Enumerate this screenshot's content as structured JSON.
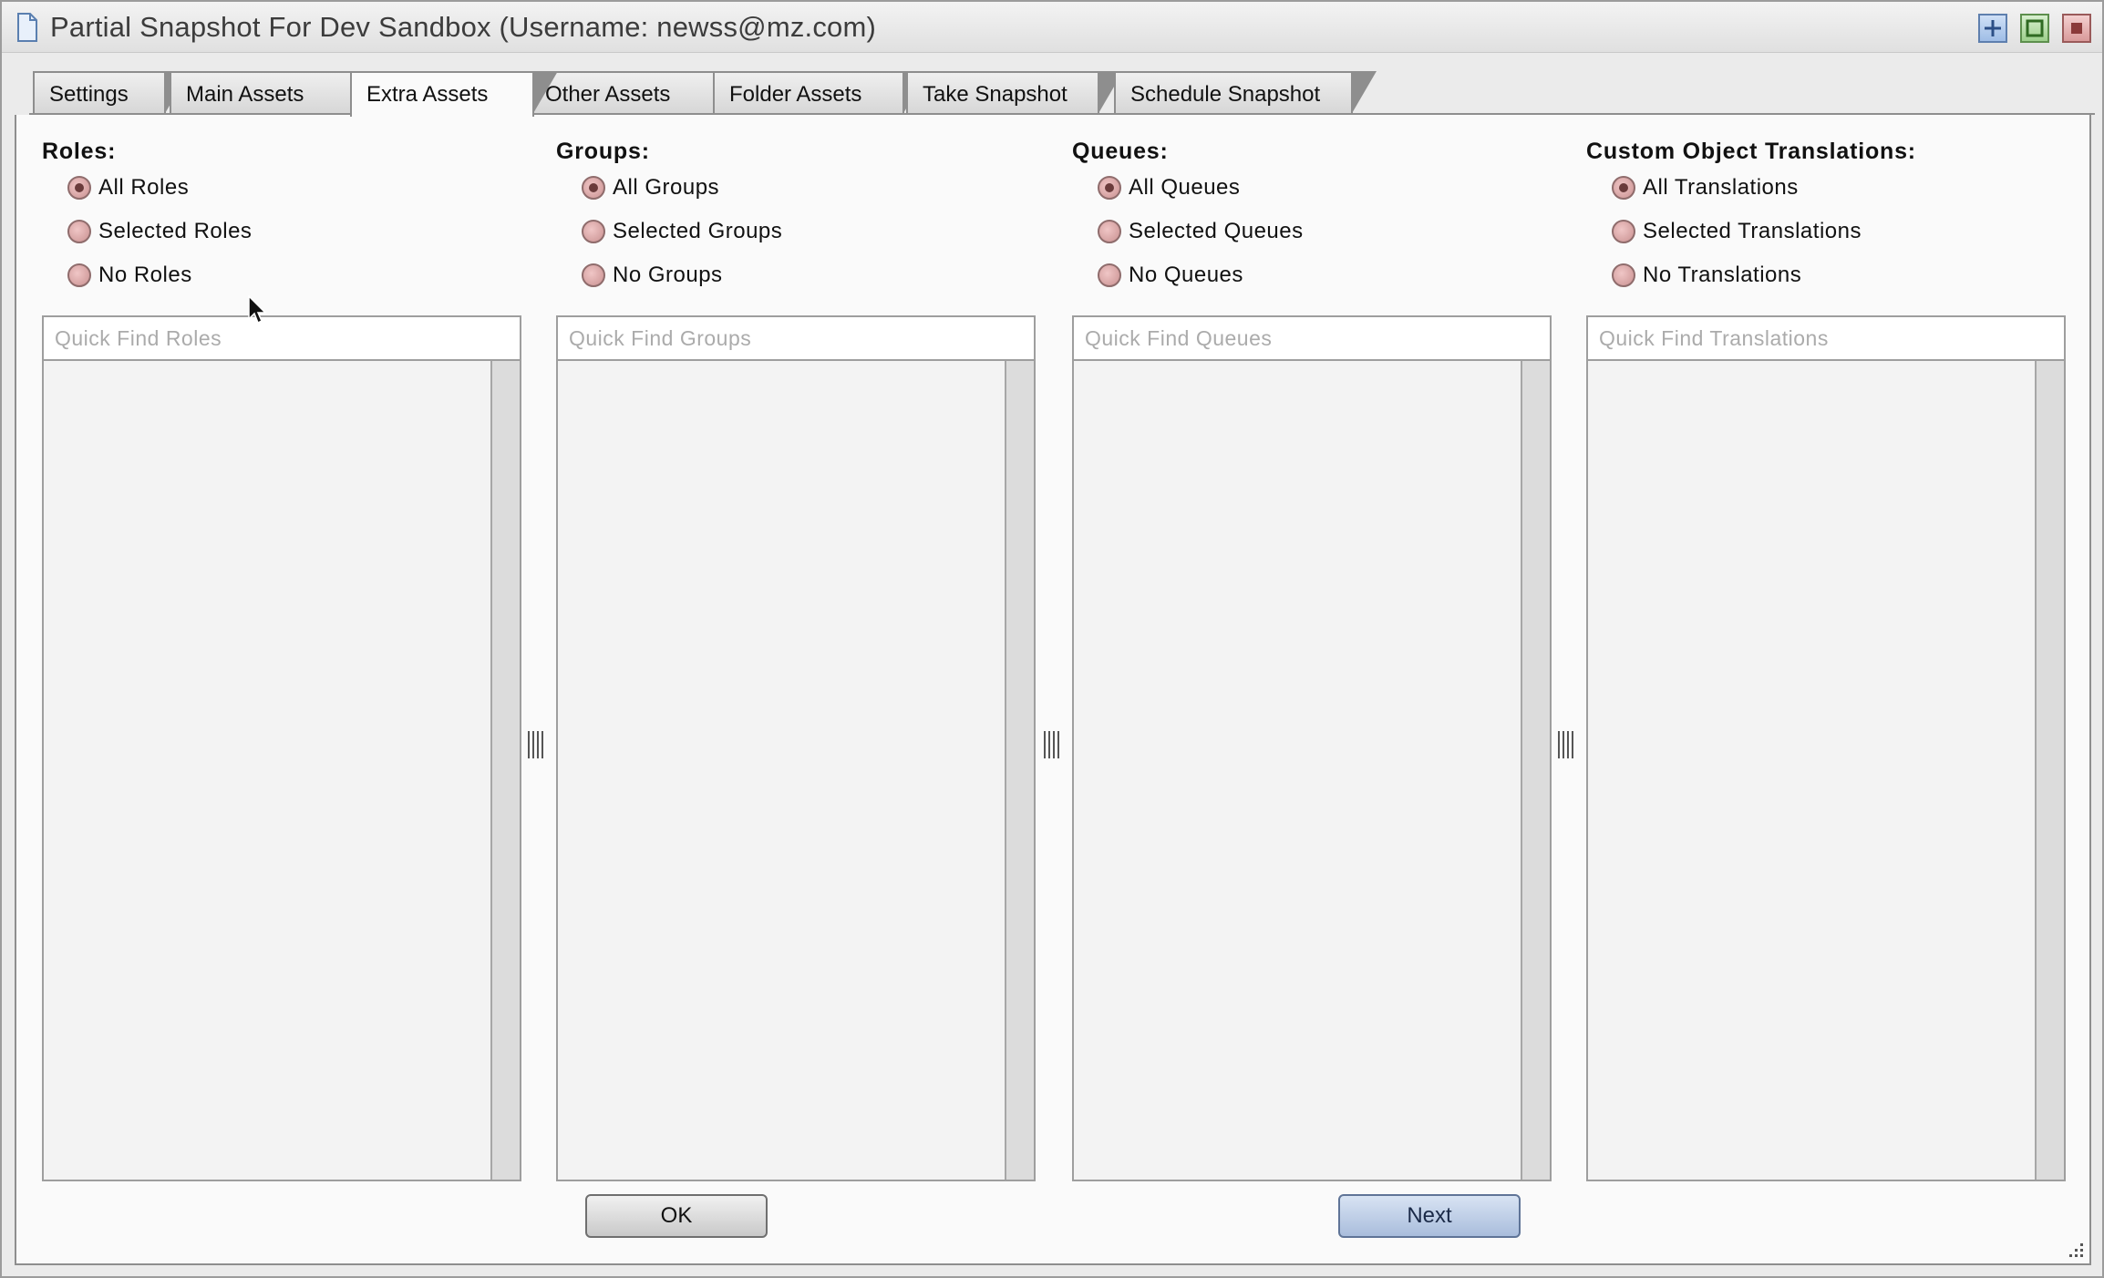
{
  "window": {
    "title": "Partial Snapshot For Dev Sandbox (Username: newss@mz.com)",
    "icons": [
      "document-icon",
      "plus-icon",
      "maximize-icon",
      "close-icon"
    ]
  },
  "tabs": [
    {
      "label": "Settings",
      "active": false
    },
    {
      "label": "Main Assets",
      "active": false
    },
    {
      "label": "Extra Assets",
      "active": true
    },
    {
      "label": "Other Assets",
      "active": false
    },
    {
      "label": "Folder Assets",
      "active": false
    },
    {
      "label": "Take Snapshot",
      "active": false
    },
    {
      "label": "Schedule Snapshot",
      "active": false
    }
  ],
  "columns": [
    {
      "heading": "Roles:",
      "options": [
        {
          "label": "All Roles",
          "selected": true
        },
        {
          "label": "Selected Roles",
          "selected": false
        },
        {
          "label": "No Roles",
          "selected": false
        }
      ],
      "search_placeholder": "Quick Find Roles"
    },
    {
      "heading": "Groups:",
      "options": [
        {
          "label": "All Groups",
          "selected": true
        },
        {
          "label": "Selected Groups",
          "selected": false
        },
        {
          "label": "No Groups",
          "selected": false
        }
      ],
      "search_placeholder": "Quick Find Groups"
    },
    {
      "heading": "Queues:",
      "options": [
        {
          "label": "All Queues",
          "selected": true
        },
        {
          "label": "Selected Queues",
          "selected": false
        },
        {
          "label": "No Queues",
          "selected": false
        }
      ],
      "search_placeholder": "Quick Find Queues"
    },
    {
      "heading": "Custom Object Translations:",
      "options": [
        {
          "label": "All Translations",
          "selected": true
        },
        {
          "label": "Selected Translations",
          "selected": false
        },
        {
          "label": "No Translations",
          "selected": false
        }
      ],
      "search_placeholder": "Quick Find Translations"
    }
  ],
  "buttons": {
    "ok_label": "OK",
    "next_label": "Next"
  },
  "colors": {
    "radio_fill": "#c99191",
    "next_button": "#a9bddc"
  }
}
